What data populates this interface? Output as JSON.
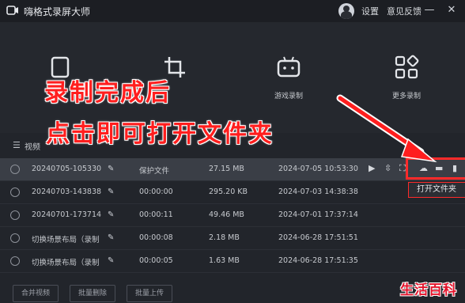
{
  "app": {
    "title": "嗨格式录屏大师"
  },
  "titlebar": {
    "settings_label": "设置",
    "feedback_label": "意见反馈",
    "minimize_glyph": "—",
    "close_glyph": "✕"
  },
  "modes": [
    {
      "label": "",
      "icon": "screen-record-icon"
    },
    {
      "label": "",
      "icon": "region-record-icon"
    },
    {
      "label": "游戏录制",
      "icon": "gamepad-icon"
    },
    {
      "label": "更多录制",
      "icon": "grid-icon"
    }
  ],
  "annotation": {
    "line1": "录制完成后",
    "line2": "点击即可打开文件夹"
  },
  "list": {
    "header_title": "视频",
    "rows": [
      {
        "name": "20240705-105330",
        "duration": "保护文件",
        "size": "27.15 MB",
        "date": "2024-07-05 10:53:30",
        "selected": true
      },
      {
        "name": "20240703-143838",
        "duration": "00:00:00",
        "size": "295.20 KB",
        "date": "2024-07-03 14:38:38",
        "selected": false
      },
      {
        "name": "20240701-173714",
        "duration": "00:00:11",
        "size": "49.46 MB",
        "date": "2024-07-01 17:37:14",
        "selected": false
      },
      {
        "name": "切换场景布局（录制",
        "duration": "00:00:08",
        "size": "2.18 MB",
        "date": "2024-06-28 17:51:51",
        "selected": false
      },
      {
        "name": "切换场景布局（录制",
        "duration": "00:00:05",
        "size": "1.63 MB",
        "date": "2024-06-28 17:51:35",
        "selected": false
      }
    ]
  },
  "tooltip": {
    "text": "打开文件夹"
  },
  "bottom": {
    "merge_label": "合并视频",
    "batch_delete_label": "批量删除",
    "batch_upload_label": "批量上传"
  },
  "watermark": {
    "text": "生活百科"
  },
  "colors": {
    "annotation_red": "#ff1e1e",
    "background": "#22252b",
    "selected_row": "#3a3e46"
  }
}
